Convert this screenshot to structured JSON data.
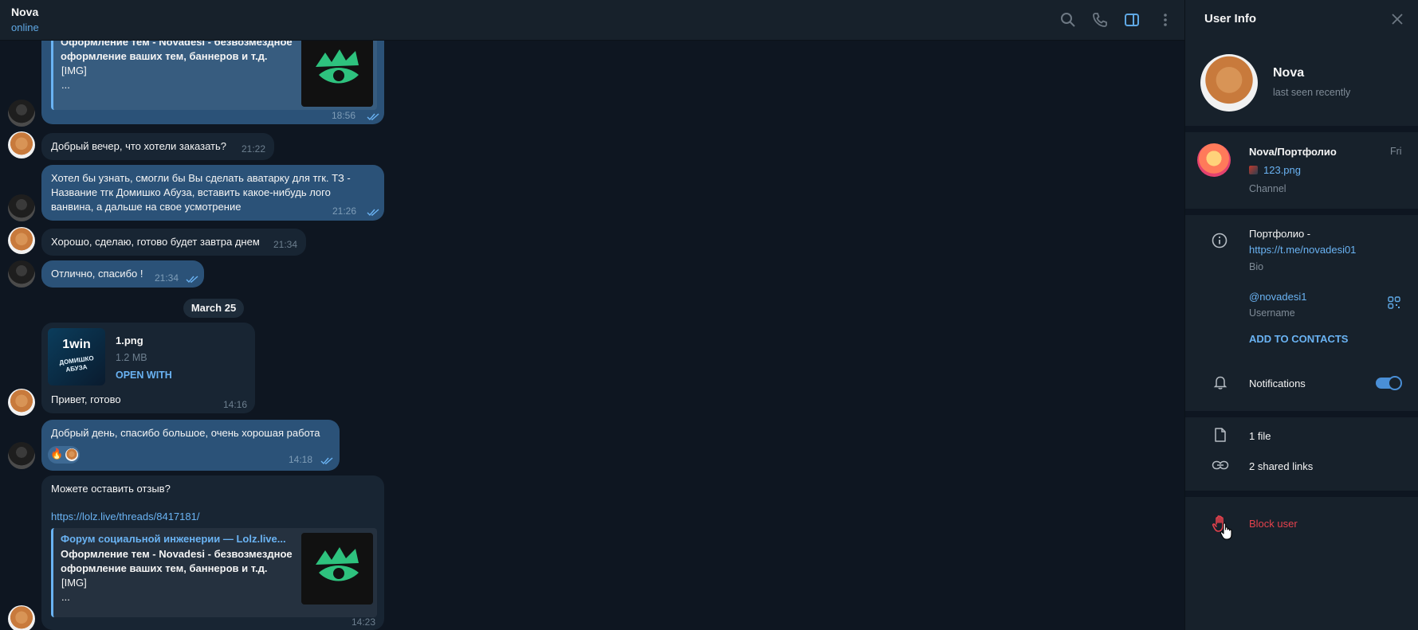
{
  "header": {
    "peer_name": "Nova",
    "peer_status": "online"
  },
  "icons": {
    "search": "search-icon",
    "call": "phone-icon",
    "sidebar": "sidebar-toggle-icon",
    "menu": "more-vertical-icon",
    "close": "close-icon"
  },
  "messages": {
    "m1": {
      "quote_text": "Оформление тем - Novadesi - безвозмездное\nоформление ваших тем, баннеров и т.д.",
      "quote_img": "[IMG]",
      "quote_more": "...",
      "time": "18:56"
    },
    "m2": {
      "text": "Добрый вечер, что хотели заказать?",
      "time": "21:22"
    },
    "m3": {
      "text": "Хотел бы узнать, смогли бы Вы сделать аватарку для тгк. ТЗ -\nНазвание тгк Домишко Абуза, вставить какое-нибудь лого\nванвина, а дальше на свое усмотрение",
      "time": "21:26"
    },
    "m4": {
      "text": "Хорошо, сделаю, готово будет завтра днем",
      "time": "21:34"
    },
    "m5": {
      "text": "Отлично, спасибо !",
      "time": "21:34"
    },
    "date_separator": "March 25",
    "m6": {
      "thumb_line1": "1win",
      "thumb_line2": "ДОМИШКО",
      "thumb_line3": "АБУЗА",
      "file_name": "1.png",
      "file_size": "1.2 MB",
      "open_with": "OPEN WITH",
      "text": "Привет, готово",
      "time": "14:16"
    },
    "m7": {
      "text": "Добрый день, спасибо большое, очень хорошая работа",
      "reaction": "🔥",
      "time": "14:18"
    },
    "m8": {
      "text": "Можете оставить отзыв?",
      "link": "https://lolz.live/threads/8417181/",
      "quote_title": "Форум социальной инженерии — Lolz.live...",
      "quote_text": "Оформление тем - Novadesi - безвозмездное\nоформление ваших тем, баннеров и т.д.",
      "quote_img": "[IMG]",
      "quote_more": "...",
      "time": "14:23"
    }
  },
  "user_info": {
    "title": "User Info",
    "name": "Nova",
    "last_seen": "last seen recently",
    "channel": {
      "name": "Nova/Портфолио",
      "date": "Fri",
      "file": "123.png",
      "label": "Channel"
    },
    "bio_text": "Портфолио -",
    "bio_link": "https://t.me/novadesi01",
    "bio_label": "Bio",
    "username": "@novadesi1",
    "username_label": "Username",
    "add_contacts": "ADD TO CONTACTS",
    "notifications": "Notifications",
    "notifications_on": true,
    "files": "1 file",
    "links": "2 shared links",
    "block": "Block user"
  },
  "colors": {
    "accent": "#6ab3f3",
    "outgoing_bubble": "#2b5278",
    "incoming_bubble": "#182533",
    "danger": "#e5424d"
  }
}
